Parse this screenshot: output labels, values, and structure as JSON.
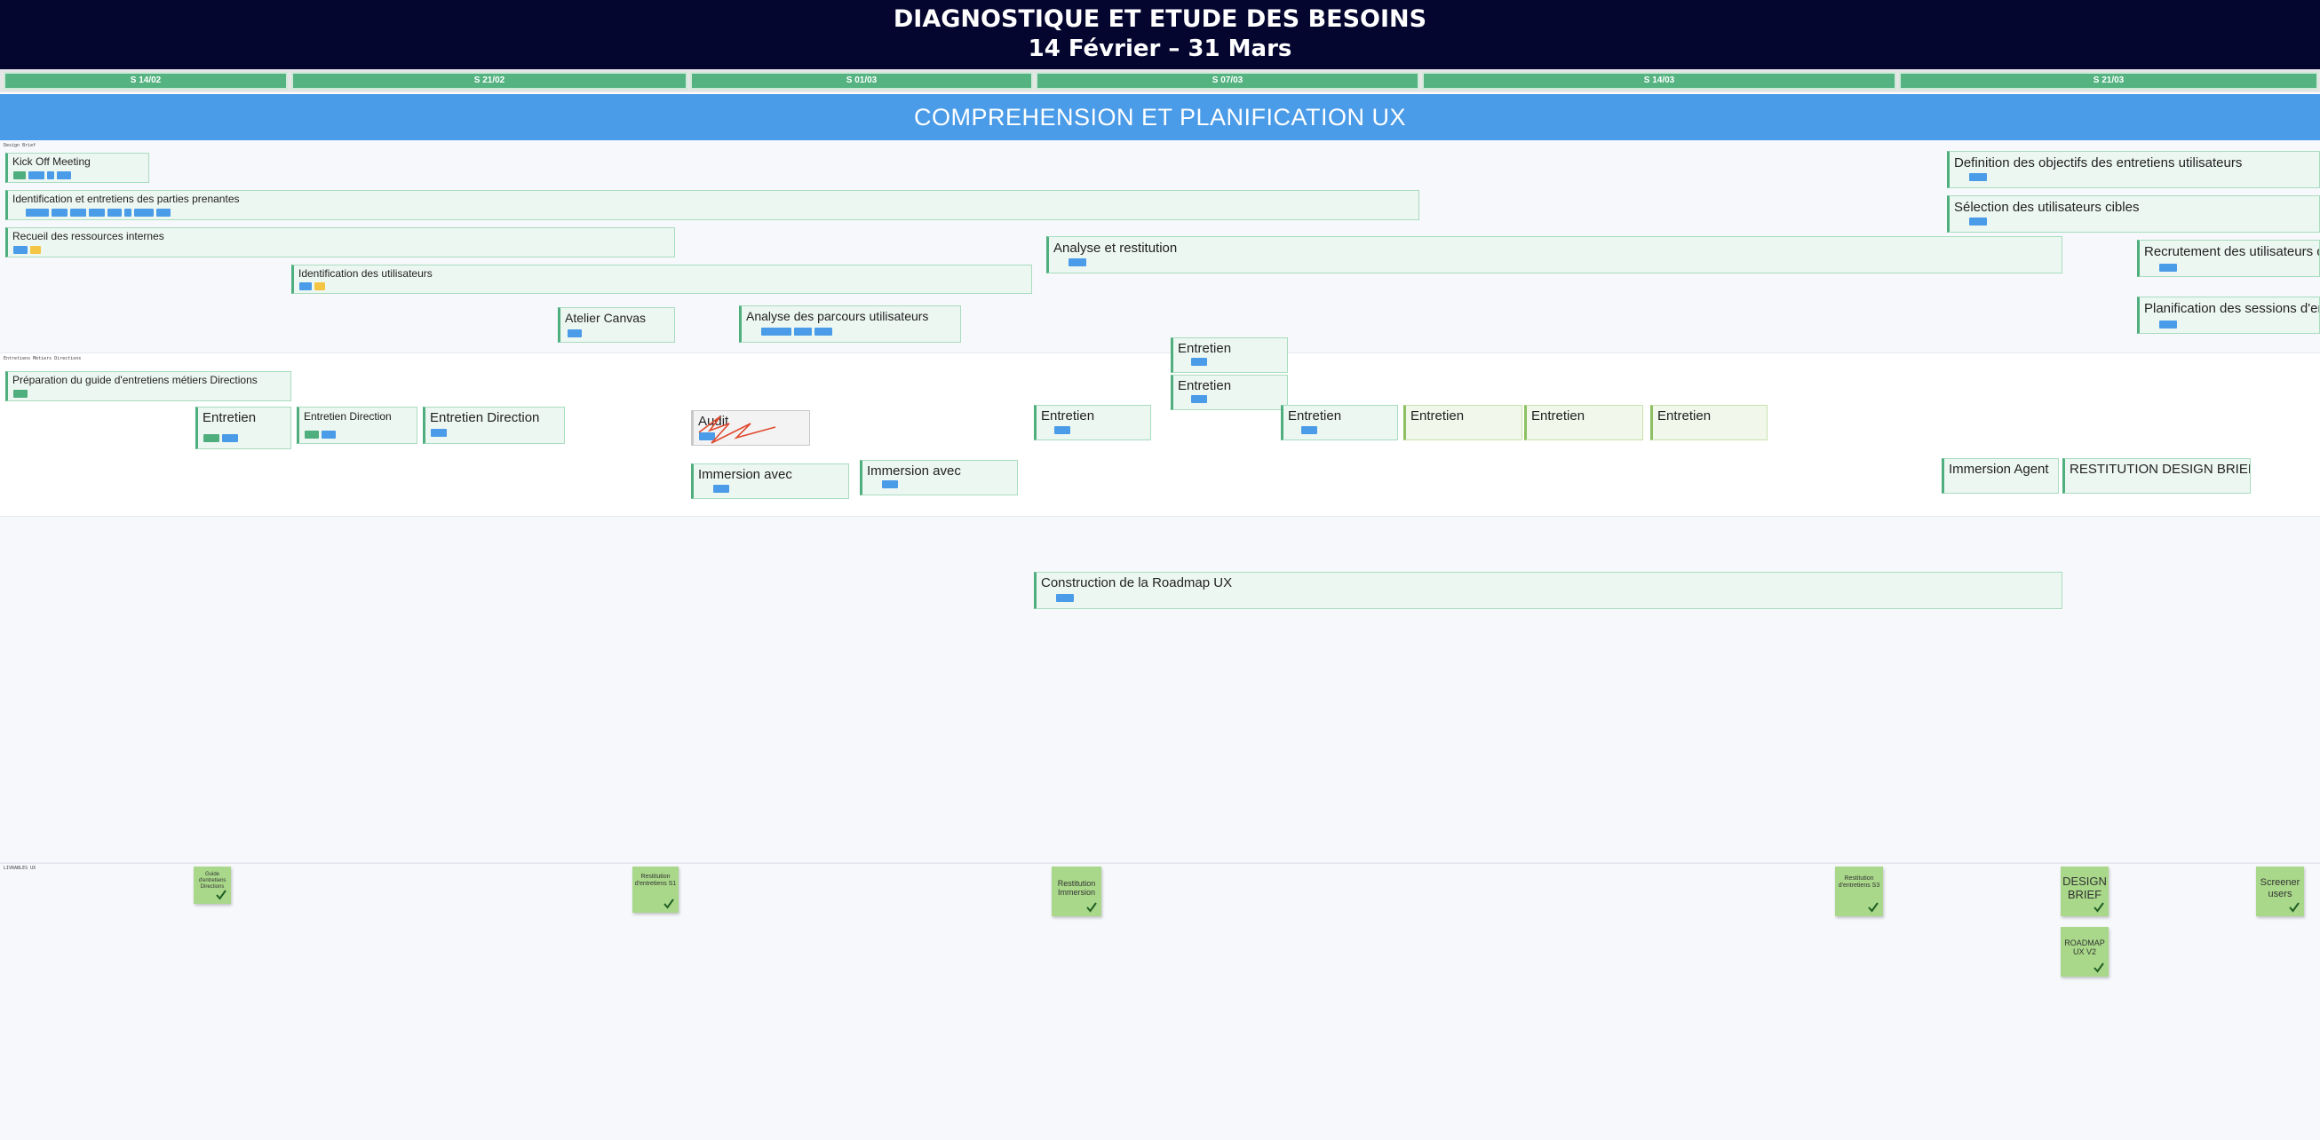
{
  "header": {
    "title_line1": "DIAGNOSTIQUE ET ETUDE DES BESOINS",
    "title_line2": "14 Février – 31 Mars"
  },
  "weeks": [
    "S 14/02",
    "S 21/02",
    "S 01/03",
    "S 07/03",
    "S 14/03",
    "S 21/03"
  ],
  "banner": "COMPREHENSION ET PLANIFICATION UX",
  "sections": {
    "design_brief": "Design Brief",
    "entretiens": "Entretiens Métiers Directions",
    "livrables": "LIVRABLES UX"
  },
  "tasks": {
    "kickoff": "Kick Off Meeting",
    "parties": "Identification et entretiens des parties prenantes",
    "recueil": "Recueil des ressources internes",
    "ident_users": "Identification des utilisateurs",
    "atelier": "Atelier Canvas",
    "parcours": "Analyse des parcours utilisateurs",
    "analyse": "Analyse et restitution",
    "definition": "Definition des objectifs des entretiens utilisateurs",
    "selection": "Sélection des utilisateurs cibles",
    "recrutement": "Recrutement des utilisateurs c",
    "planification": "Planification des sessions d'en",
    "preparation": "Préparation du guide d'entretiens métiers Directions",
    "entretien": "Entretien",
    "entretien_direction": "Entretien Direction",
    "audit": "Audit",
    "immersion_avec": "Immersion avec",
    "immersion_agent": "Immersion Agent",
    "restitution_brief": "RESTITUTION DESIGN BRIEF",
    "roadmap": "Construction de la Roadmap UX"
  },
  "deliverables": {
    "guide": "Guide d'entretiens Directions",
    "restitution_s1": "Restitution d'entretiens S1",
    "restitution_immersion": "Restitution Immersion",
    "restitution_s3": "Restitution d'entretiens S3",
    "design_brief": "DESIGN BRIEF",
    "roadmap_v2": "ROADMAP UX V2",
    "screener": "Screener users"
  },
  "colors": {
    "header_bg": "#040630",
    "banner_blue": "#4a9be8",
    "week_green": "#55b381",
    "task_border_green": "#4fae7d",
    "sticky_green": "#a9d88a",
    "chip_yellow": "#f4c542",
    "scribble_red": "#e04a2f"
  }
}
